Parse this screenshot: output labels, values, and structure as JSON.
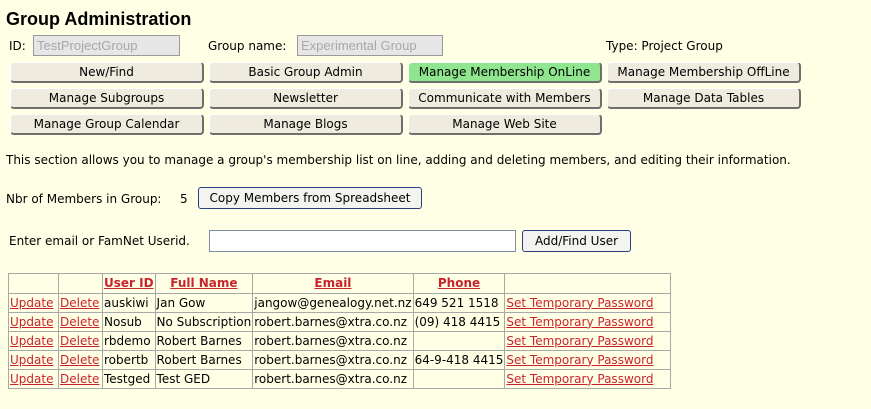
{
  "header": {
    "title": "Group Administration",
    "id_label": "ID:",
    "id_value": "TestProjectGroup",
    "group_name_label": "Group name:",
    "group_name_value": "Experimental Group",
    "type_text": "Type: Project Group"
  },
  "nav": {
    "active": "Manage Membership OnLine",
    "rows": [
      [
        "New/Find",
        "Basic Group Admin",
        "Manage Membership OnLine",
        "Manage Membership OffLine"
      ],
      [
        "Manage Subgroups",
        "Newsletter",
        "Communicate with Members",
        "Manage Data Tables"
      ],
      [
        "Manage Group Calendar",
        "Manage Blogs",
        "Manage Web Site"
      ]
    ]
  },
  "description": "This section allows you to manage a group's membership list on line, adding and deleting members, and editing their information.",
  "members_count": {
    "label": "Nbr of Members in Group:",
    "value": "5",
    "copy_button": "Copy Members from Spreadsheet"
  },
  "lookup": {
    "label": "Enter email or FamNet Userid.",
    "input_value": "",
    "button": "Add/Find User"
  },
  "table": {
    "headers": [
      "",
      "",
      "User ID",
      "Full Name",
      "Email",
      "Phone",
      ""
    ],
    "update_label": "Update",
    "delete_label": "Delete",
    "password_label": "Set Temporary Password",
    "rows": [
      {
        "user_id": "auskiwi",
        "full_name": "Jan Gow",
        "email": "jangow@genealogy.net.nz",
        "phone": "649 521 1518"
      },
      {
        "user_id": "Nosub",
        "full_name": "No Subscription",
        "email": "robert.barnes@xtra.co.nz",
        "phone": "(09) 418 4415"
      },
      {
        "user_id": "rbdemo",
        "full_name": "Robert Barnes",
        "email": "robert.barnes@xtra.co.nz",
        "phone": ""
      },
      {
        "user_id": "robertb",
        "full_name": "Robert Barnes",
        "email": "robert.barnes@xtra.co.nz",
        "phone": "64-9-418 4415"
      },
      {
        "user_id": "Testged",
        "full_name": "Test GED",
        "email": "robert.barnes@xtra.co.nz",
        "phone": ""
      }
    ]
  },
  "colors": {
    "background": "#ffffe6",
    "active_tab": "#8fe68f",
    "tab": "#efebde",
    "link": "#c8242e"
  }
}
